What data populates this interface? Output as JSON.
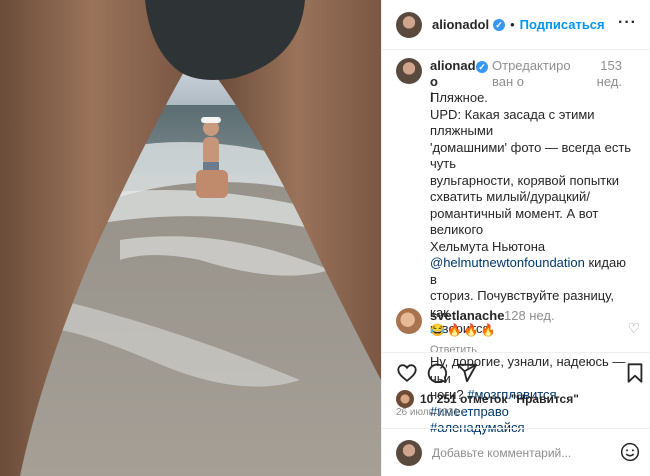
{
  "post": {
    "username": "alionadol",
    "verified": true,
    "follow_label": "Подписаться",
    "more_icon": "more-horizontal-icon"
  },
  "caption": {
    "username_line1": "alionado",
    "username_line2": "l",
    "edited_label": "Отредактирован о",
    "age": "153 нед.",
    "lines": [
      "Пляжное.",
      "UPD: Какая засада с этими пляжными",
      "'домашними' фото — всегда есть чуть",
      "вульгарности, корявой попытки",
      "схватить милый/дурацкий/",
      "романтичный момент. А вот великого",
      "Хельмута Ньютона"
    ],
    "mention": "@helmutnewtonfoundation",
    "after_mention": " кидаю в",
    "lines2": [
      "сториз. Почувствуйте разницу, как",
      "говорится."
    ],
    "lines3_prefix": "Ну, дорогие, узнали, надеюсь — чьи",
    "lines3_prefix2": "ноги? ",
    "tags": [
      "#мозгплавится",
      "#имеетправо",
      "#аленадумайся"
    ]
  },
  "comment": {
    "username": "svetlanache",
    "age": "128 нед.",
    "text": "😂🔥🔥🔥",
    "reply_label": "Ответить"
  },
  "stats": {
    "likes_text": "10 251 отметок \"Нравится\"",
    "date": "26 июль 2021 г."
  },
  "add_comment": {
    "placeholder": "Добавьте комментарий..."
  },
  "colors": {
    "accent": "#0095f6",
    "verified": "#3897f0",
    "link": "#00376b",
    "muted": "#8e8e8e"
  }
}
